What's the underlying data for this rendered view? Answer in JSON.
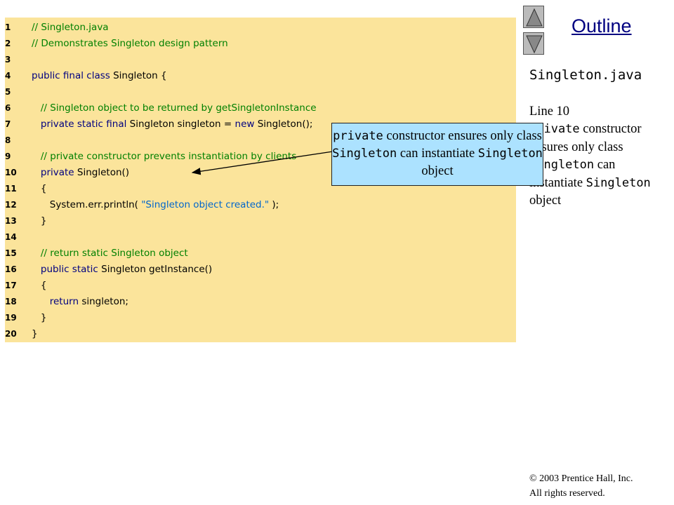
{
  "code": {
    "lines": [
      {
        "num": "1",
        "tokens": [
          {
            "t": "// Singleton.java",
            "c": "comment"
          }
        ]
      },
      {
        "num": "2",
        "tokens": [
          {
            "t": "// Demonstrates Singleton design pattern",
            "c": "comment"
          }
        ]
      },
      {
        "num": "3",
        "tokens": []
      },
      {
        "num": "4",
        "tokens": [
          {
            "t": "public final class ",
            "c": "keyword"
          },
          {
            "t": "Singleton {",
            "c": "plain"
          }
        ]
      },
      {
        "num": "5",
        "tokens": []
      },
      {
        "num": "6",
        "tokens": [
          {
            "t": "   // Singleton object to be returned by getSingletonInstance",
            "c": "comment"
          }
        ]
      },
      {
        "num": "7",
        "tokens": [
          {
            "t": "   private static final ",
            "c": "keyword"
          },
          {
            "t": "Singleton singleton = ",
            "c": "plain"
          },
          {
            "t": "new ",
            "c": "keyword"
          },
          {
            "t": "Singleton();",
            "c": "plain"
          }
        ]
      },
      {
        "num": "8",
        "tokens": []
      },
      {
        "num": "9",
        "tokens": [
          {
            "t": "   // private constructor prevents instantiation by clients",
            "c": "comment"
          }
        ]
      },
      {
        "num": "10",
        "tokens": [
          {
            "t": "   private ",
            "c": "keyword"
          },
          {
            "t": "Singleton()",
            "c": "plain"
          }
        ]
      },
      {
        "num": "11",
        "tokens": [
          {
            "t": "   {",
            "c": "plain"
          }
        ]
      },
      {
        "num": "12",
        "tokens": [
          {
            "t": "      System.err.println( ",
            "c": "plain"
          },
          {
            "t": "\"Singleton object created.\"",
            "c": "string"
          },
          {
            "t": " );",
            "c": "plain"
          }
        ]
      },
      {
        "num": "13",
        "tokens": [
          {
            "t": "   }",
            "c": "plain"
          }
        ]
      },
      {
        "num": "14",
        "tokens": []
      },
      {
        "num": "15",
        "tokens": [
          {
            "t": "   // return static Singleton object",
            "c": "comment"
          }
        ]
      },
      {
        "num": "16",
        "tokens": [
          {
            "t": "   public static ",
            "c": "keyword"
          },
          {
            "t": "Singleton getInstance()",
            "c": "plain"
          }
        ]
      },
      {
        "num": "17",
        "tokens": [
          {
            "t": "   {",
            "c": "plain"
          }
        ]
      },
      {
        "num": "18",
        "tokens": [
          {
            "t": "      return ",
            "c": "keyword"
          },
          {
            "t": "singleton;",
            "c": "plain"
          }
        ]
      },
      {
        "num": "19",
        "tokens": [
          {
            "t": "   }",
            "c": "plain"
          }
        ]
      },
      {
        "num": "20",
        "tokens": [
          {
            "t": "}",
            "c": "plain"
          }
        ]
      }
    ]
  },
  "nav": {
    "up_icon": "triangle-up-icon",
    "down_icon": "triangle-down-icon",
    "outline_label": "Outline"
  },
  "sidebar": {
    "file_title": "Singleton.java",
    "note_line_ref": "Line 10",
    "note_kw_private": "private",
    "note_text_1": " constructor ensures only class ",
    "note_kw_class": "Singleton",
    "note_text_2": " can instantiate ",
    "note_kw_obj": "Singleton",
    "note_text_3": " object"
  },
  "callout": {
    "kw_private": "private",
    "text_1": " constructor ensures only class ",
    "kw_class": "Singleton",
    "text_2": " can instantiate ",
    "kw_obj": "Singleton",
    "text_3": " object"
  },
  "footer": {
    "copyright": "© 2003 Prentice Hall, Inc.",
    "rights": "All rights reserved."
  },
  "colors": {
    "code_bg": "#fbe49b",
    "callout_bg": "#ace2ff",
    "comment": "#008000",
    "keyword": "#000080",
    "string": "#0066cc"
  }
}
